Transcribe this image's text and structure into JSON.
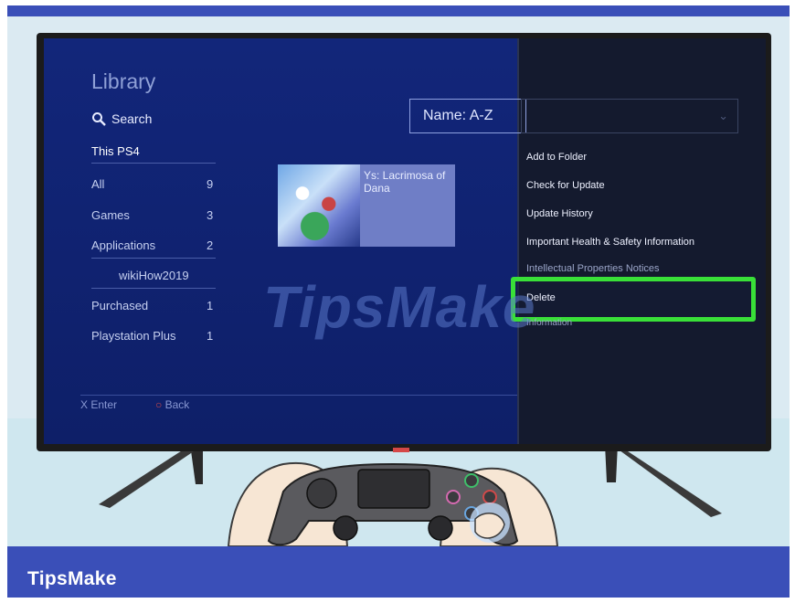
{
  "library": {
    "title": "Library",
    "search_label": "Search",
    "section": "This PS4",
    "items": [
      {
        "label": "All",
        "count": "9"
      },
      {
        "label": "Games",
        "count": "3"
      },
      {
        "label": "Applications",
        "count": "2"
      },
      {
        "label": "wikiHow2019",
        "count": ""
      },
      {
        "label": "Purchased",
        "count": "1"
      },
      {
        "label": "Playstation Plus",
        "count": "1"
      }
    ],
    "sort_label": "Name: A-Z",
    "game_title": "Ys: Lacrimosa of Dana"
  },
  "context_menu": {
    "items": [
      "Add to Folder",
      "Check for Update",
      "Update History",
      "Important Health & Safety Information",
      "Intellectual Properties Notices",
      "Delete",
      "Information"
    ]
  },
  "hints": {
    "enter": "X  Enter",
    "back": "Back"
  },
  "watermark": "TipsMake",
  "banner": "TipsMake",
  "colors": {
    "highlight": "#39e038",
    "banner": "#3a4fb8",
    "screen": "#10226f"
  }
}
